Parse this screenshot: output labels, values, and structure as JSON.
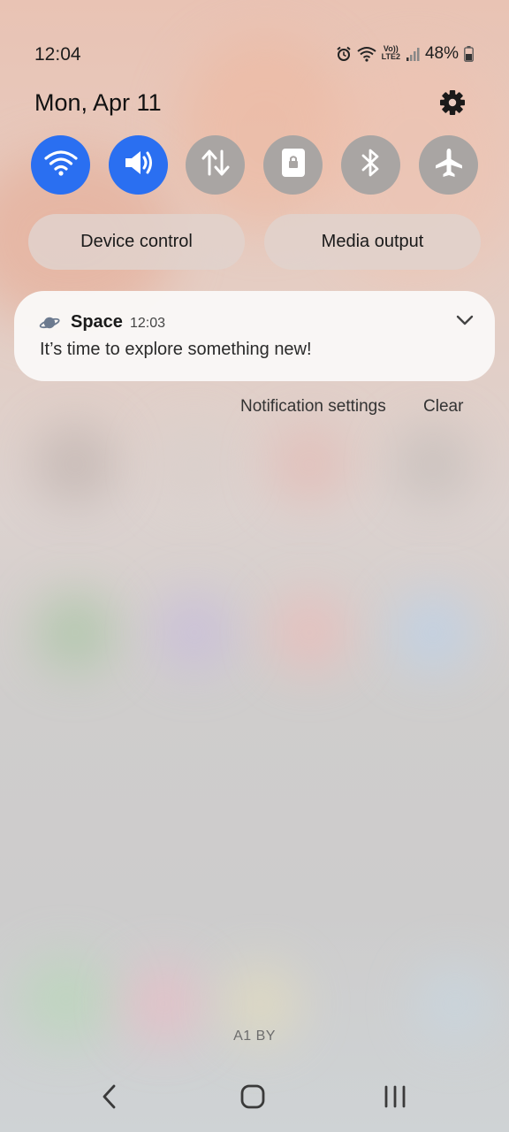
{
  "status_bar": {
    "time": "12:04",
    "network_label": "Vo))\nLTE2",
    "battery_percent": "48%",
    "icons": [
      "alarm-icon",
      "wifi-icon",
      "volte-lte-icon",
      "signal-icon",
      "battery-icon"
    ]
  },
  "quick_panel": {
    "date": "Mon, Apr 11",
    "settings_icon": "gear-icon",
    "toggles": [
      {
        "name": "wifi",
        "icon": "wifi-icon",
        "state": "on"
      },
      {
        "name": "sound",
        "icon": "speaker-icon",
        "state": "on"
      },
      {
        "name": "mobile-data",
        "icon": "data-arrows-icon",
        "state": "off"
      },
      {
        "name": "screen-lock",
        "icon": "lock-icon",
        "state": "off"
      },
      {
        "name": "bluetooth",
        "icon": "bluetooth-icon",
        "state": "off"
      },
      {
        "name": "airplane-mode",
        "icon": "airplane-icon",
        "state": "off"
      }
    ],
    "accent_color": "#2a6ff1",
    "off_color": "#a9a5a3",
    "device_control_label": "Device control",
    "media_output_label": "Media output"
  },
  "notification": {
    "app_name": "Space",
    "time": "12:03",
    "message": "It’s time to explore something new!",
    "app_icon": "planet-icon",
    "expand_icon": "chevron-down-icon"
  },
  "notification_actions": {
    "settings_label": "Notification settings",
    "clear_label": "Clear"
  },
  "carrier_label": "A1 BY",
  "nav_bar": {
    "back_icon": "back-icon",
    "home_icon": "home-icon",
    "recents_icon": "recents-icon"
  }
}
